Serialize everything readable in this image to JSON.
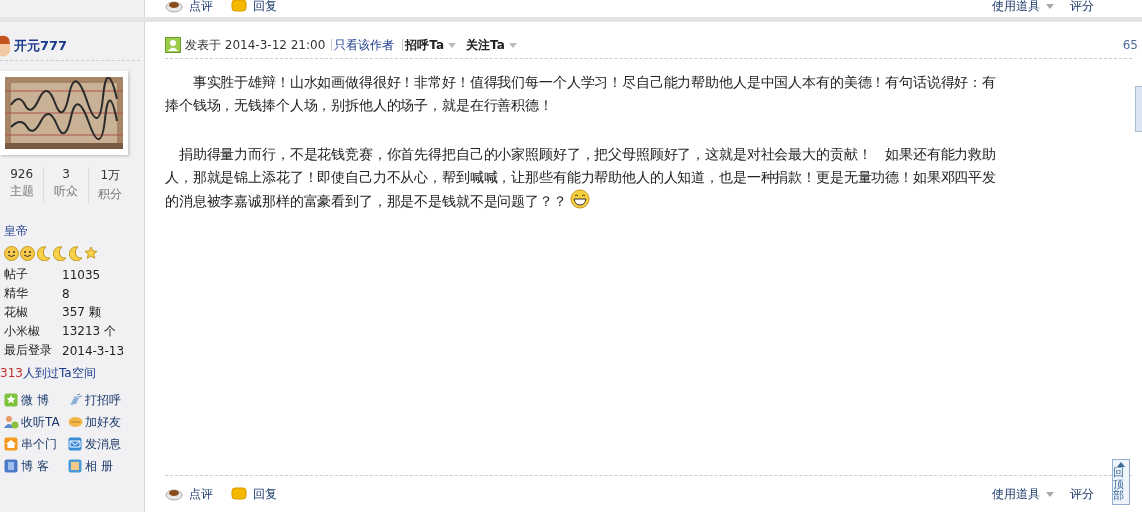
{
  "previous_post_actions": {
    "left": [
      {
        "kind": "comment",
        "label": "点评"
      },
      {
        "kind": "reply",
        "label": "回复"
      }
    ],
    "right": [
      {
        "kind": "dropdown",
        "label": "使用道具"
      },
      {
        "kind": "plain",
        "label": "评分"
      }
    ]
  },
  "author": {
    "username": "开元777",
    "stats": [
      {
        "value": "926",
        "label": "主题"
      },
      {
        "value": "3",
        "label": "听众"
      },
      {
        "value": "1万",
        "label": "积分"
      }
    ],
    "rank": "皇帝",
    "info": [
      {
        "label": "帖子",
        "value": "11035"
      },
      {
        "label": "精华",
        "value": "8"
      },
      {
        "label": "花椒",
        "value": "357 颗"
      },
      {
        "label": "小米椒",
        "value": "13213 个"
      },
      {
        "label": "最后登录",
        "value": "2014-3-13"
      }
    ],
    "visits": {
      "count": "313",
      "text": "人到过Ta空间"
    },
    "actions": [
      {
        "kind": "weibo",
        "label": "微 博"
      },
      {
        "kind": "greet",
        "label": "打招呼"
      },
      {
        "kind": "follow",
        "label": "收听TA"
      },
      {
        "kind": "friend",
        "label": "加好友"
      },
      {
        "kind": "home",
        "label": "串个门"
      },
      {
        "kind": "message",
        "label": "发消息"
      },
      {
        "kind": "blog",
        "label": "博 客"
      },
      {
        "kind": "album",
        "label": "相 册"
      }
    ]
  },
  "post": {
    "posted": "发表于 2014-3-12 21:00",
    "author_only": "只看该作者",
    "menus": [
      "招呼Ta",
      "关注Ta"
    ],
    "floor": "65",
    "paragraphs": [
      {
        "lines": [
          "　　事实胜于雄辩！山水如画做得很好！非常好！值得我们每一个人学习！尽自己能力帮助他人是中国人本有的美德！有句话说得好：有",
          "捧个钱场，无钱捧个人场，别拆他人的场子，就是在行善积德！"
        ],
        "emoji": false
      },
      {
        "lines": [
          "　捐助得量力而行，不是花钱竞赛，你首先得把自己的小家照顾好了，把父母照顾好了，这就是对社会最大的贡献！　如果还有能力救助",
          "人，那就是锦上添花了！即使自己力不从心，帮到喊喊，让那些有能力帮助他人的人知道，也是一种捐款！更是无量功德！如果邓四平发",
          "的消息被李嘉诚那样的富豪看到了，那是不是钱就不是问题了？？"
        ],
        "emoji": true
      }
    ]
  },
  "post_actions": {
    "left": [
      {
        "kind": "comment",
        "label": "点评"
      },
      {
        "kind": "reply",
        "label": "回复"
      }
    ],
    "right": [
      {
        "kind": "dropdown",
        "label": "使用道具"
      },
      {
        "kind": "plain",
        "label": "评分"
      }
    ]
  },
  "back_to_top": "回顶部"
}
